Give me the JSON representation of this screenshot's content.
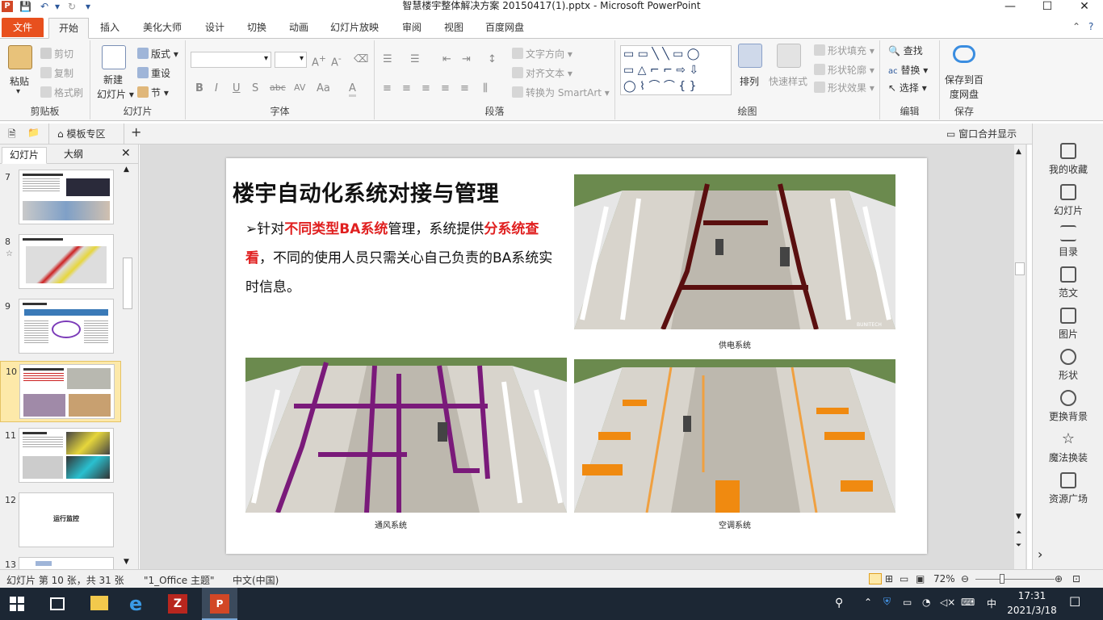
{
  "window": {
    "title": "智慧楼宇整体解决方案 20150417(1).pptx - Microsoft PowerPoint",
    "app_icon_letter": "P"
  },
  "tabs": {
    "file": "文件",
    "items": [
      "开始",
      "插入",
      "美化大师",
      "设计",
      "切换",
      "动画",
      "幻灯片放映",
      "审阅",
      "视图",
      "百度网盘"
    ]
  },
  "ribbon": {
    "clipboard": {
      "paste": "粘贴",
      "cut": "剪切",
      "copy": "复制",
      "format_painter": "格式刷",
      "label": "剪贴板"
    },
    "slides": {
      "new_slide_line1": "新建",
      "new_slide_line2": "幻灯片",
      "layout": "版式",
      "reset": "重设",
      "section": "节",
      "label": "幻灯片"
    },
    "font": {
      "font_name": "",
      "font_size": "",
      "label": "字体",
      "bold": "B",
      "italic": "I",
      "underline": "U",
      "shadow": "S",
      "strike": "abc",
      "spacing": "AV",
      "case": "Aa",
      "color": "A"
    },
    "paragraph": {
      "text_direction": "文字方向",
      "align_text": "对齐文本",
      "convert_smartart": "转换为 SmartArt",
      "label": "段落"
    },
    "drawing": {
      "arrange": "排列",
      "quick_styles": "快速样式",
      "shape_fill": "形状填充",
      "shape_outline": "形状轮廓",
      "shape_effects": "形状效果",
      "label": "绘图"
    },
    "editing": {
      "find": "查找",
      "replace": "替换",
      "select": "选择",
      "label": "编辑"
    },
    "save": {
      "save_to_baidu_line1": "保存到百",
      "save_to_baidu_line2": "度网盘",
      "label": "保存"
    }
  },
  "docbar": {
    "template_zone": "模板专区",
    "merge_windows": "窗口合并显示"
  },
  "left_panel": {
    "tab_slides": "幻灯片",
    "tab_outline": "大纲",
    "thumbnails": [
      {
        "num": "7",
        "text": ""
      },
      {
        "num": "8",
        "text": ""
      },
      {
        "num": "9",
        "text": ""
      },
      {
        "num": "10",
        "text": ""
      },
      {
        "num": "11",
        "text": ""
      },
      {
        "num": "12",
        "text": "运行监控"
      },
      {
        "num": "13",
        "text": ""
      }
    ]
  },
  "slide": {
    "title": "楼宇自动化系统对接与管理",
    "bullet_marker": "➢",
    "bullet_parts": {
      "p1": "针对",
      "p2": "不同类型BA系统",
      "p3": "管理，系统提供",
      "p4": "分系统查看",
      "p5": "，不同的使用人员只需关心自己负责的BA系统实时信息。"
    },
    "captions": {
      "power": "供电系统",
      "ventilation": "通风系统",
      "aircon": "空调系统"
    },
    "watermark": "BUNITECH",
    "colors": {
      "power_pipes": "#5a0f0f",
      "vent_pipes": "#7a1a7a",
      "ac_pipes": "#f08a10",
      "highlight": "#e02020"
    }
  },
  "right_pane": {
    "items": [
      "我的收藏",
      "幻灯片",
      "目录",
      "范文",
      "图片",
      "形状",
      "更换背景",
      "魔法换装",
      "资源广场"
    ]
  },
  "status": {
    "slide_info": "幻灯片 第 10 张，共 31 张",
    "theme": "\"1_Office 主题\"",
    "language": "中文(中国)",
    "zoom": "72%"
  },
  "taskbar": {
    "time": "17:31",
    "date": "2021/3/18",
    "ime": "中"
  }
}
